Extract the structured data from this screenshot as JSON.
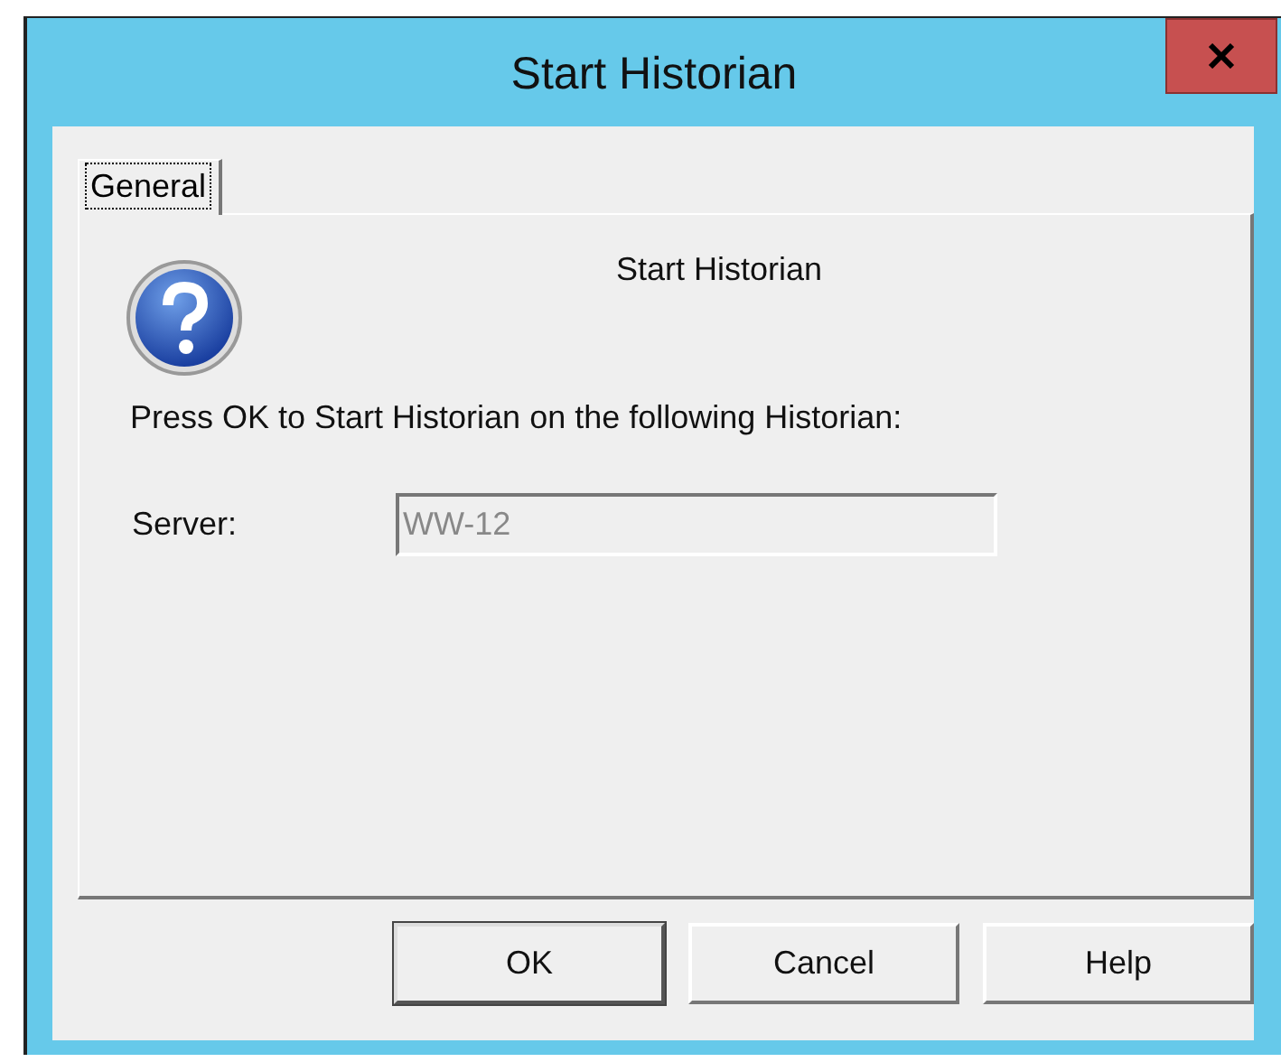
{
  "window": {
    "title": "Start Historian"
  },
  "tabs": [
    {
      "label": "General",
      "selected": true
    }
  ],
  "heading": "Start Historian",
  "message": "Press OK to Start Historian on the following Historian:",
  "server": {
    "label": "Server:",
    "value": "WW-12",
    "disabled": true
  },
  "buttons": [
    {
      "label": "OK",
      "default": true
    },
    {
      "label": "Cancel",
      "default": false
    },
    {
      "label": "Help",
      "default": false
    }
  ]
}
